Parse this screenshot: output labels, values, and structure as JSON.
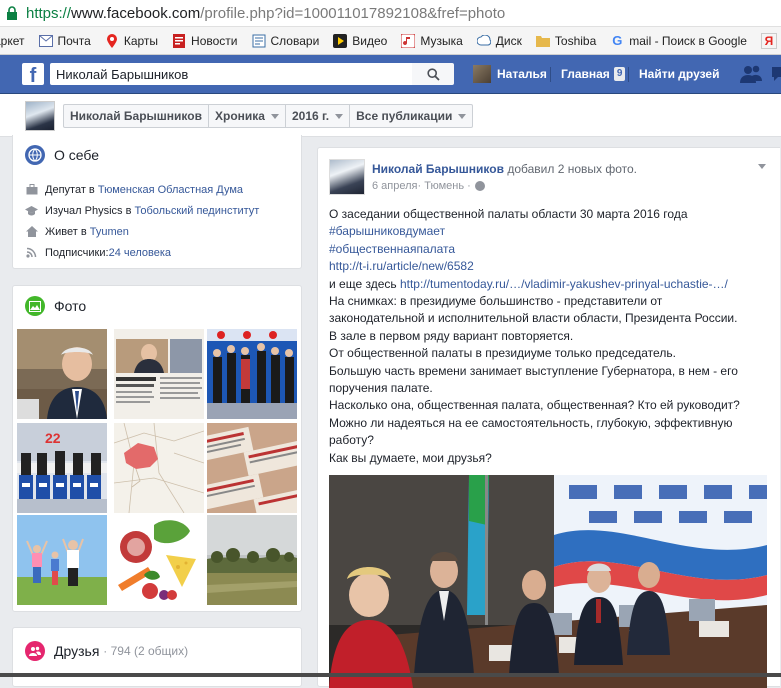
{
  "browser": {
    "url_scheme": "https://",
    "url_host": "www.facebook.com",
    "url_path": "/profile.php?id=100011017892108&fref=photo",
    "bookmarks": [
      {
        "label": "аркет",
        "icon": "market-icon"
      },
      {
        "label": "Почта",
        "icon": "mail-icon"
      },
      {
        "label": "Карты",
        "icon": "map-pin-icon"
      },
      {
        "label": "Новости",
        "icon": "news-icon"
      },
      {
        "label": "Словари",
        "icon": "dictionary-icon"
      },
      {
        "label": "Видео",
        "icon": "video-icon"
      },
      {
        "label": "Музыка",
        "icon": "music-icon"
      },
      {
        "label": "Диск",
        "icon": "disk-icon"
      },
      {
        "label": "Toshiba",
        "icon": "folder-icon"
      },
      {
        "label": "mail - Поиск в Google",
        "icon": "google-icon"
      }
    ]
  },
  "fb_header": {
    "search_value": "Николай Барышников",
    "user_name": "Наталья",
    "home_label": "Главная",
    "home_count": "9",
    "find_friends_label": "Найти друзей"
  },
  "timeline_nav": {
    "name": "Николай Барышников",
    "section": "Хроника",
    "year": "2016 г.",
    "filter": "Все публикации"
  },
  "about": {
    "title": "О себе",
    "items": [
      {
        "prefix": "Депутат в ",
        "link": "Тюменская Областная Дума"
      },
      {
        "prefix": "Изучал Physics в ",
        "link": "Тобольский пединститут"
      },
      {
        "prefix": "Живет в ",
        "link": "Tyumen"
      },
      {
        "prefix": "Подписчики: ",
        "link": "24 человека"
      }
    ]
  },
  "photos": {
    "title": "Фото"
  },
  "friends": {
    "title": "Друзья",
    "count": "· 794 (2 общих)"
  },
  "post": {
    "author": "Николай Барышников",
    "action": " добавил 2 новых фото.",
    "date": "6 апреля",
    "location": " · Тюмень · ",
    "lines": [
      {
        "text": "О заседании общественной палаты области 30 марта 2016 года",
        "link": false
      },
      {
        "text": "#барышниковдумает",
        "link": true
      },
      {
        "text": "#общественнаяпалата",
        "link": true
      },
      {
        "text": "http://t-i.ru/article/new/6582",
        "link": true
      }
    ],
    "more_prefix": "и еще здесь ",
    "more_link": "http://tumentoday.ru/…/vladimir-yakushev-prinyal-uchastie-…/",
    "body_lines": [
      "На снимках: в президиуме большинство - представители от",
      "законодательной и исполнительной власти области, Президента России.",
      "В зале в первом ряду вариант повторяется.",
      "От общественной палаты в президиуме только председатель.",
      "Большую часть времени занимает выступление Губернатора, в нем - его",
      "поручения палате.",
      "Насколько она, общественная палата, общественная? Кто ей руководит?",
      "Можно ли надеяться на ее самостоятельность, глубокую, эффективную",
      "работу?",
      "Как вы думаете, мои друзья?"
    ]
  },
  "colors": {
    "fb_blue": "#4267b2",
    "link": "#365899",
    "page_bg": "#e9ebee"
  }
}
